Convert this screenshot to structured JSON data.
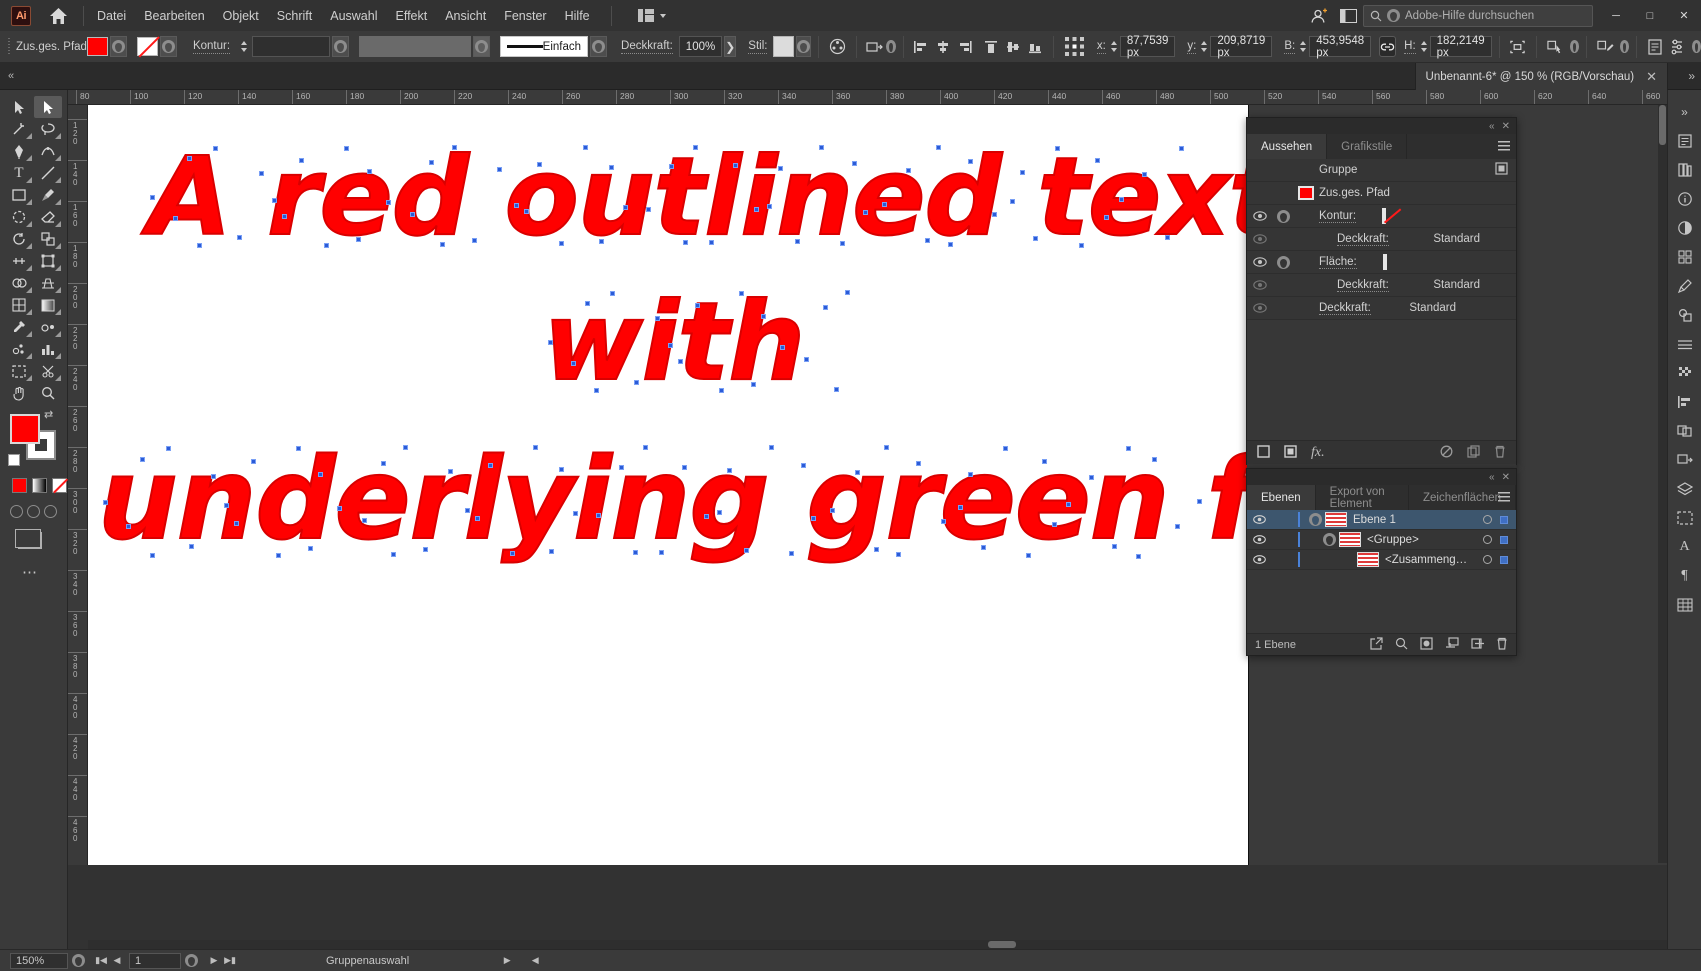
{
  "app": {
    "logo": "Ai",
    "home_icon": "home-icon",
    "menus": [
      "Datei",
      "Bearbeiten",
      "Objekt",
      "Schrift",
      "Auswahl",
      "Effekt",
      "Ansicht",
      "Fenster",
      "Hilfe"
    ],
    "workspace_switcher": "workspace-icon",
    "search_placeholder": "Adobe-Hilfe durchsuchen",
    "window_controls": [
      "minimize",
      "maximize",
      "close"
    ],
    "accent_red": "#ff0000",
    "panel_bg": "#353535"
  },
  "control_bar": {
    "object_label": "Zus.ges. Pfad",
    "fill_swatch": "#ff0000",
    "stroke_swatch": "none",
    "stroke_label": "Kontur:",
    "stroke_weight": "",
    "stroke_profile_label": "",
    "stroke_style": "Einfach",
    "opacity_label": "Deckkraft:",
    "opacity_value": "100%",
    "style_label": "Stil:",
    "coords": {
      "x_label": "x:",
      "x_value": "87,7539 px",
      "y_label": "y:",
      "y_value": "209,8719 px",
      "w_label": "B:",
      "w_value": "453,9548 px",
      "h_label": "H:",
      "h_value": "182,2149 px",
      "link_icon": "chain-link-icon"
    }
  },
  "document": {
    "tab_title": "Unbenannt-6* @ 150 % (RGB/Vorschau)",
    "close_icon": "close-icon"
  },
  "canvas": {
    "artboard_bg": "#ffffff",
    "text_color": "#ff0000",
    "lines": [
      "A red outlined text",
      "with",
      "underlying green fill"
    ]
  },
  "rulers": {
    "horizontal": [
      "80",
      "100",
      "120",
      "140",
      "160",
      "180",
      "200",
      "220",
      "240",
      "260",
      "280",
      "300",
      "320",
      "340",
      "360",
      "380",
      "400",
      "420",
      "440",
      "460",
      "480",
      "500",
      "520",
      "540",
      "560",
      "580",
      "600",
      "620",
      "640",
      "660"
    ],
    "vertical": [
      "120",
      "140",
      "160",
      "180",
      "200",
      "220",
      "240",
      "260",
      "280",
      "300",
      "320",
      "340",
      "360",
      "380",
      "400",
      "420",
      "440",
      "460"
    ]
  },
  "tools": [
    {
      "name": "selection-tool",
      "glyph": "▲"
    },
    {
      "name": "direct-selection-tool",
      "glyph": "▶"
    },
    {
      "name": "magic-wand-tool",
      "glyph": "✦"
    },
    {
      "name": "lasso-tool",
      "glyph": "◠"
    },
    {
      "name": "pen-tool",
      "glyph": "✒"
    },
    {
      "name": "curvature-tool",
      "glyph": "✎"
    },
    {
      "name": "type-tool",
      "glyph": "T"
    },
    {
      "name": "line-segment-tool",
      "glyph": "／"
    },
    {
      "name": "rectangle-tool",
      "glyph": "▭"
    },
    {
      "name": "paintbrush-tool",
      "glyph": "🖌"
    },
    {
      "name": "shaper-tool",
      "glyph": "◌"
    },
    {
      "name": "eraser-tool",
      "glyph": "▰"
    },
    {
      "name": "rotate-tool",
      "glyph": "↻"
    },
    {
      "name": "scale-tool",
      "glyph": "⤢"
    },
    {
      "name": "width-tool",
      "glyph": "⌗"
    },
    {
      "name": "free-transform-tool",
      "glyph": "⬚"
    },
    {
      "name": "shape-builder-tool",
      "glyph": "⌬"
    },
    {
      "name": "perspective-grid-tool",
      "glyph": "◱"
    },
    {
      "name": "mesh-tool",
      "glyph": "⊞"
    },
    {
      "name": "gradient-tool",
      "glyph": "▤"
    },
    {
      "name": "eyedropper-tool",
      "glyph": "⟟"
    },
    {
      "name": "blend-tool",
      "glyph": "⦾"
    },
    {
      "name": "symbol-sprayer-tool",
      "glyph": "⁂"
    },
    {
      "name": "column-graph-tool",
      "glyph": "▥"
    },
    {
      "name": "artboard-tool",
      "glyph": "◻"
    },
    {
      "name": "slice-tool",
      "glyph": "✂"
    },
    {
      "name": "hand-tool",
      "glyph": "✋"
    },
    {
      "name": "zoom-tool",
      "glyph": "🔍"
    }
  ],
  "appearance_panel": {
    "tabs": [
      {
        "label": "Aussehen",
        "active": true
      },
      {
        "label": "Grafikstile",
        "active": false
      }
    ],
    "rows": [
      {
        "name": "Gruppe",
        "type": "group",
        "eye": false,
        "twisty": false,
        "thumb": false,
        "value": ""
      },
      {
        "name": "Zus.ges. Pfad",
        "type": "path",
        "eye": false,
        "twisty": false,
        "thumb": "fill",
        "value": ""
      },
      {
        "name": "Kontur:",
        "type": "stroke",
        "eye": true,
        "twisty": true,
        "thumb": "none",
        "value": ""
      },
      {
        "name": "Deckkraft:",
        "type": "opacity",
        "eye": true,
        "dim": true,
        "indent": 2,
        "value": "Standard"
      },
      {
        "name": "Fläche:",
        "type": "fill",
        "eye": true,
        "twisty": true,
        "thumb": "fill",
        "value": ""
      },
      {
        "name": "Deckkraft:",
        "type": "opacity",
        "eye": true,
        "dim": true,
        "indent": 2,
        "value": "Standard"
      },
      {
        "name": "Deckkraft:",
        "type": "opacity",
        "eye": true,
        "dim": true,
        "indent": 1,
        "value": "Standard"
      }
    ],
    "footer_icons": [
      "add-new-stroke-icon",
      "add-new-fill-icon",
      "add-effect-icon",
      "clear-appearance-icon",
      "duplicate-item-icon",
      "delete-item-icon"
    ]
  },
  "layers_panel": {
    "tabs": [
      {
        "label": "Ebenen",
        "active": true
      },
      {
        "label": "Export von Element",
        "active": false
      },
      {
        "label": "Zeichenflächen",
        "active": false
      }
    ],
    "rows": [
      {
        "label": "Ebene 1",
        "indent": 0,
        "selected": true,
        "twisty": true,
        "eye": true
      },
      {
        "label": "<Gruppe>",
        "indent": 1,
        "selected": false,
        "twisty": true,
        "eye": true
      },
      {
        "label": "<Zusammeng…",
        "indent": 2,
        "selected": false,
        "twisty": false,
        "eye": true
      }
    ],
    "status": "1 Ebene",
    "footer_icons": [
      "locate-object-icon",
      "make-clipping-mask-icon",
      "create-new-sublayer-icon",
      "create-new-layer-icon",
      "delete-selection-icon"
    ]
  },
  "dock_icons": [
    "properties-icon",
    "libraries-icon",
    "info-icon",
    "color-icon",
    "swatches-icon",
    "brushes-icon",
    "symbols-icon",
    "stroke-icon",
    "transparency-icon",
    "align-icon",
    "pathfinder-icon",
    "transform-icon",
    "layers-icon",
    "artboards-icon",
    "character-icon",
    "paragraph-icon",
    "glyphs-icon"
  ],
  "status_bar": {
    "zoom": "150%",
    "page": "1",
    "tool_status": "Gruppenauswahl"
  }
}
